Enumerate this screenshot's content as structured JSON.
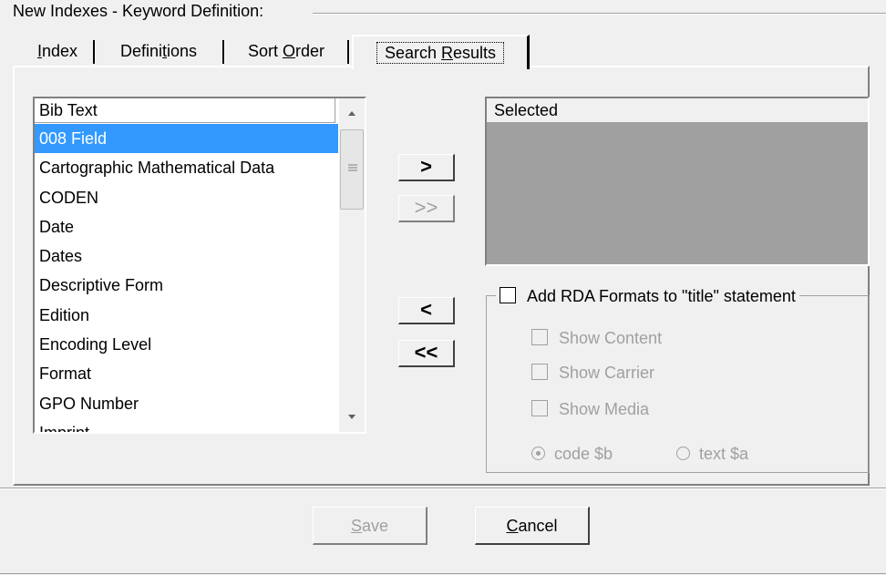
{
  "group_title": "New Indexes - Keyword Definition:",
  "tabs": [
    {
      "label_pre": "",
      "label_u": "I",
      "label_post": "ndex"
    },
    {
      "label_pre": "Defini",
      "label_u": "t",
      "label_post": "ions"
    },
    {
      "label_pre": "Sort ",
      "label_u": "O",
      "label_post": "rder"
    },
    {
      "label_pre": "Search ",
      "label_u": "R",
      "label_post": "esults"
    }
  ],
  "active_tab": "Search Results",
  "available_list": {
    "header": "Bib Text",
    "items": [
      "008 Field",
      "Cartographic Mathematical Data",
      "CODEN",
      "Date",
      "Dates",
      "Descriptive Form",
      "Edition",
      "Encoding Level",
      "Format",
      "GPO Number",
      "Imprint"
    ],
    "selected_item": "008 Field"
  },
  "move_buttons": {
    "add": ">",
    "add_all": ">>",
    "remove": "<",
    "remove_all": "<<"
  },
  "selected_list": {
    "header": "Selected"
  },
  "rda": {
    "title": "Add RDA Formats to \"title\" statement",
    "checked": false,
    "options": {
      "show_content": "Show Content",
      "show_carrier": "Show Carrier",
      "show_media": "Show Media"
    },
    "radio_code": "code $b",
    "radio_text": "text $a",
    "radio_selected": "code $b"
  },
  "buttons": {
    "save_u": "S",
    "save_rest": "ave",
    "cancel_u": "C",
    "cancel_rest": "ancel"
  },
  "colors": {
    "selection": "#3399ff",
    "selected_box_bg": "#a0a0a0",
    "disabled_text": "#a0a0a0"
  }
}
